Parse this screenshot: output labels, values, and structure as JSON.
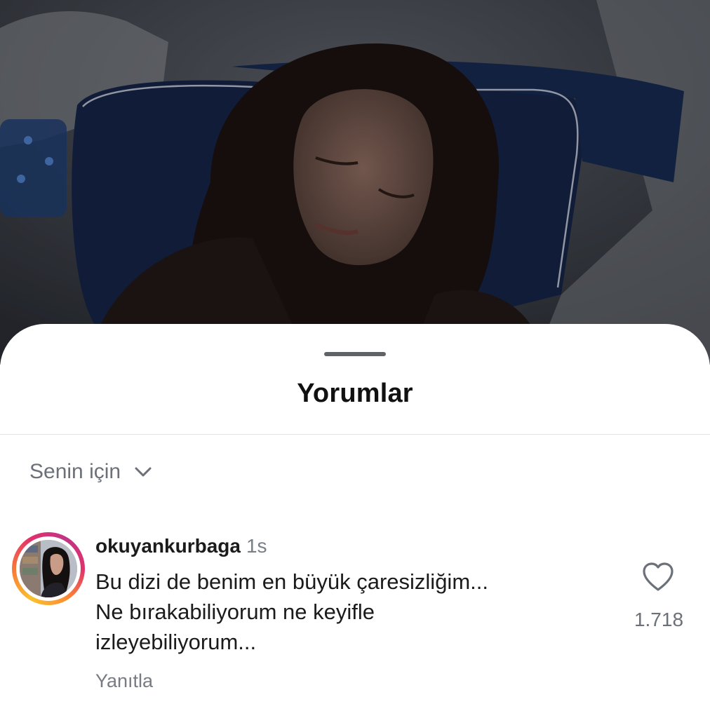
{
  "sheet": {
    "title": "Yorumlar",
    "filter": {
      "label": "Senin için",
      "icon": "chevron-down-icon"
    }
  },
  "comment": {
    "username": "okuyankurbaga",
    "timestamp": "1s",
    "text_lines": [
      "Bu dizi de benim en büyük çaresizliğim...",
      "Ne bırakabiliyorum ne keyifle",
      "izleyebiliyorum..."
    ],
    "likes": "1.718",
    "like_icon": "heart-outline-icon",
    "reply_label": "Yanıtla"
  },
  "colors": {
    "story_ring_start": "#f9c22e",
    "story_ring_mid": "#e1306c",
    "story_ring_end": "#c13584",
    "muted_text": "#6b7079"
  }
}
